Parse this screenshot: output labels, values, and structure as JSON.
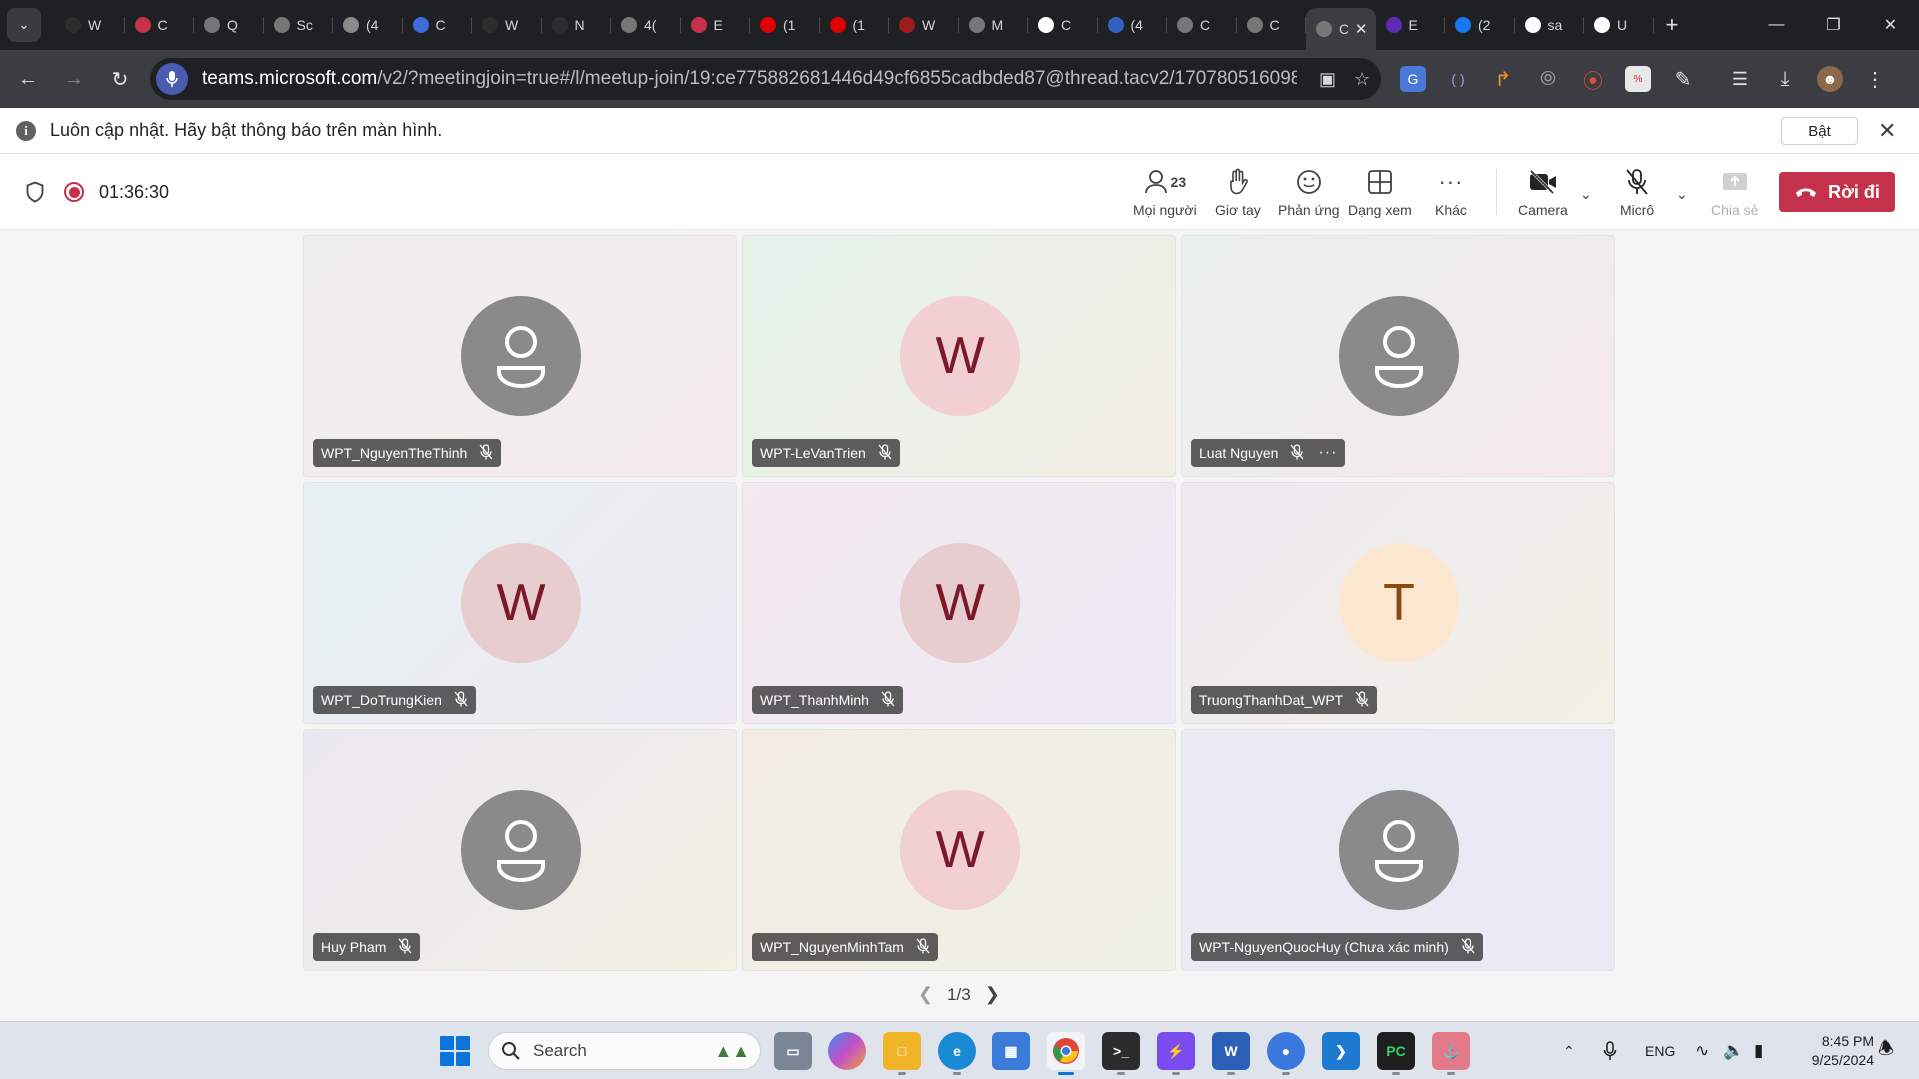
{
  "browser": {
    "tabs": [
      {
        "title": "W",
        "icon": "site-icon",
        "color": "#2d2d2d"
      },
      {
        "title": "C",
        "icon": "site-icon",
        "color": "#c4314b"
      },
      {
        "title": "Q",
        "icon": "openai-icon",
        "color": "#777777"
      },
      {
        "title": "Sc",
        "icon": "openai-icon",
        "color": "#777777"
      },
      {
        "title": "(4",
        "icon": "site-icon",
        "color": "#8a8a8a"
      },
      {
        "title": "C",
        "icon": "v-icon",
        "color": "#3d6bd8"
      },
      {
        "title": "W",
        "icon": "site-icon",
        "color": "#2d2d2d"
      },
      {
        "title": "N",
        "icon": "site-icon",
        "color": "#2d2d2d"
      },
      {
        "title": "4(",
        "icon": "openai-icon",
        "color": "#777777"
      },
      {
        "title": "E",
        "icon": "site-icon",
        "color": "#c4314b"
      },
      {
        "title": "(1",
        "icon": "youtube-icon",
        "color": "#e00000"
      },
      {
        "title": "(1",
        "icon": "youtube-icon",
        "color": "#e00000"
      },
      {
        "title": "W",
        "icon": "site-icon",
        "color": "#9c1b1b"
      },
      {
        "title": "M",
        "icon": "openai-icon",
        "color": "#777777"
      },
      {
        "title": "C",
        "icon": "chatgpt-icon",
        "color": "#ffffff"
      },
      {
        "title": "(4",
        "icon": "site-icon",
        "color": "#3060c0"
      },
      {
        "title": "C",
        "icon": "openai-icon",
        "color": "#777777"
      },
      {
        "title": "C",
        "icon": "openai-icon",
        "color": "#777777"
      },
      {
        "title": "C",
        "icon": "openai-icon",
        "color": "#777777",
        "active": true
      },
      {
        "title": "E",
        "icon": "k-icon",
        "color": "#5b2bb5"
      },
      {
        "title": "(2",
        "icon": "facebook-icon",
        "color": "#1877f2"
      },
      {
        "title": "sa",
        "icon": "google-icon",
        "color": "#ffffff"
      },
      {
        "title": "U",
        "icon": "google-icon",
        "color": "#ffffff"
      }
    ],
    "url_host": "teams.microsoft.com",
    "url_rest": "/v2/?meetingjoin=true#/l/meetup-join/19:ce775882681446d49cf6855cadbded87@thread.tacv2/1707805160980?conte..."
  },
  "notification": {
    "text": "Luôn cập nhật. Hãy bật thông báo trên màn hình.",
    "button": "Bật"
  },
  "meeting": {
    "timer": "01:36:30",
    "people_count": "23",
    "controls": {
      "people": "Mọi người",
      "raise_hand": "Giơ tay",
      "react": "Phản ứng",
      "view": "Dạng xem",
      "more": "Khác",
      "camera": "Camera",
      "mic": "Micrô",
      "share": "Chia sẻ",
      "leave": "Rời đi"
    },
    "participants": [
      {
        "name": "WPT_NguyenTheThinh",
        "avatar": "person-icon",
        "initial": ""
      },
      {
        "name": "WPT-LeVanTrien",
        "avatar": "initial",
        "initial": "W"
      },
      {
        "name": "Luat Nguyen",
        "avatar": "person-icon",
        "initial": "",
        "more": "···"
      },
      {
        "name": "WPT_DoTrungKien",
        "avatar": "initial",
        "initial": "W"
      },
      {
        "name": "WPT_ThanhMinh",
        "avatar": "initial",
        "initial": "W"
      },
      {
        "name": "TruongThanhDat_WPT",
        "avatar": "initial",
        "initial": "T"
      },
      {
        "name": "Huy Pham",
        "avatar": "person-icon",
        "initial": ""
      },
      {
        "name": "WPT_NguyenMinhTam",
        "avatar": "initial",
        "initial": "W"
      },
      {
        "name": "WPT-NguyenQuocHuy (Chưa xác minh)",
        "avatar": "person-icon",
        "initial": ""
      }
    ],
    "pager": "1/3"
  },
  "taskbar": {
    "search_placeholder": "Search",
    "language": "ENG",
    "time": "8:45 PM",
    "date": "9/25/2024"
  },
  "colors": {
    "accent_red": "#c4314b",
    "teams_purple": "#4a5bb0"
  }
}
